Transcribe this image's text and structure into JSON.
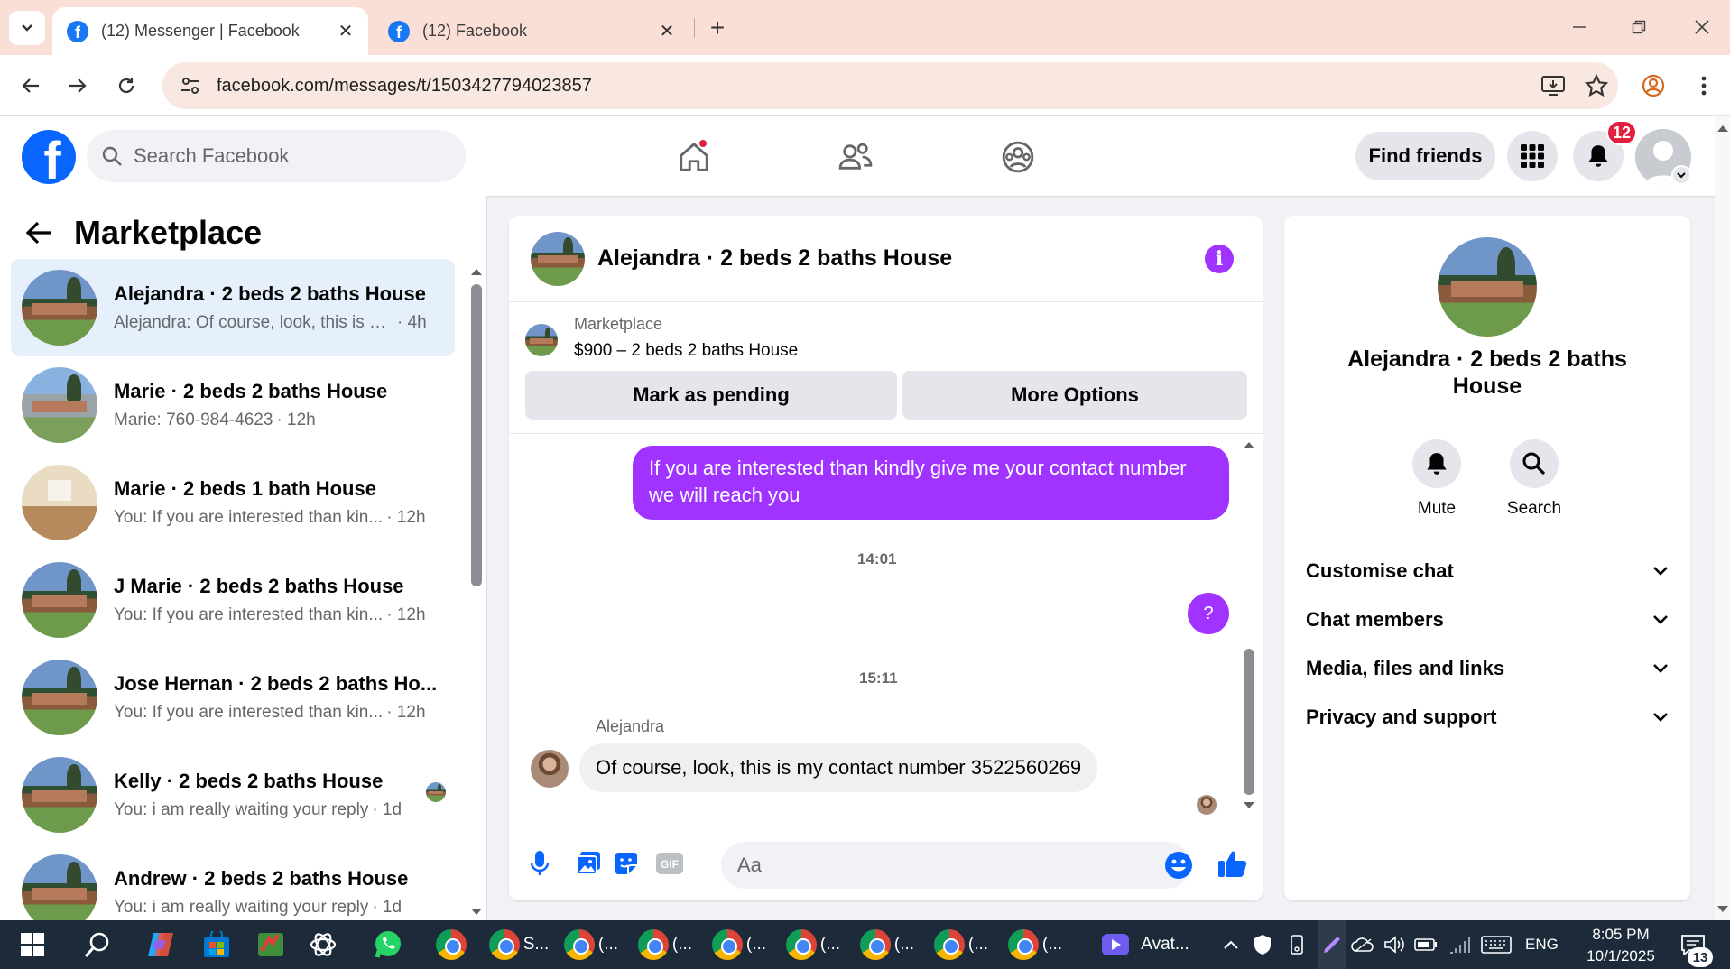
{
  "browser": {
    "tabs": [
      {
        "title": "(12) Messenger | Facebook",
        "active": true
      },
      {
        "title": "(12) Facebook",
        "active": false
      }
    ],
    "url": "facebook.com/messages/t/1503427794023857"
  },
  "header": {
    "search_placeholder": "Search Facebook",
    "find_friends": "Find friends",
    "notifications_count": "12"
  },
  "left": {
    "title": "Marketplace",
    "conversations": [
      {
        "name": "Alejandra · 2 beds 2 baths House",
        "preview": "Alejandra: Of course, look, this is m...",
        "time": "· 4h",
        "active": true,
        "thumb": "house"
      },
      {
        "name": "Marie · 2 beds 2 baths House",
        "preview": "Marie: 760-984-4623",
        "time": "· 12h",
        "thumb": "house-gray"
      },
      {
        "name": "Marie · 2 beds 1 bath House",
        "preview": "You: If you are interested than kin...",
        "time": "· 12h",
        "thumb": "house-interior"
      },
      {
        "name": "J Marie · 2 beds 2 baths House",
        "preview": "You: If you are interested than kin...",
        "time": "· 12h",
        "thumb": "house"
      },
      {
        "name": "Jose Hernan · 2 beds 2 baths Ho...",
        "preview": "You: If you are interested than kin...",
        "time": "· 12h",
        "thumb": "house"
      },
      {
        "name": "Kelly · 2 beds 2 baths House",
        "preview": "You: i am really waiting your reply",
        "time": "· 1d",
        "thumb": "house"
      },
      {
        "name": "Andrew · 2 beds 2 baths House",
        "preview": "You: i am really waiting your reply",
        "time": "· 1d",
        "thumb": "house"
      }
    ]
  },
  "chat": {
    "title": "Alejandra · 2 beds 2 baths House",
    "listing_label": "Marketplace",
    "listing_price": "$900 – 2 beds 2 baths House",
    "mark_pending": "Mark as pending",
    "more_options": "More Options",
    "out_message": "If you are interested than kindly give me your contact number we will reach you",
    "timestamp1": "14:01",
    "question_bubble": "?",
    "timestamp2": "15:11",
    "sender_name": "Alejandra",
    "in_message": "Of course, look, this is my contact number 3522560269",
    "composer_placeholder": "Aa"
  },
  "right": {
    "name": "Alejandra · 2 beds 2 baths House",
    "mute": "Mute",
    "search": "Search",
    "sections": [
      "Customise chat",
      "Chat members",
      "Media, files and links",
      "Privacy and support"
    ]
  },
  "taskbar": {
    "apps": [
      {
        "label": "S..."
      },
      {
        "label": "(..."
      },
      {
        "label": "(..."
      },
      {
        "label": "(..."
      },
      {
        "label": "(..."
      },
      {
        "label": "(..."
      },
      {
        "label": "(..."
      },
      {
        "label": "(..."
      },
      {
        "label": "Avat..."
      }
    ],
    "language": "ENG",
    "time": "8:05 PM",
    "date": "10/1/2025",
    "notification_count": "13"
  },
  "colors": {
    "facebook_blue": "#0866ff",
    "messenger_purple": "#a033ff",
    "badge_red": "#e41e3f"
  }
}
